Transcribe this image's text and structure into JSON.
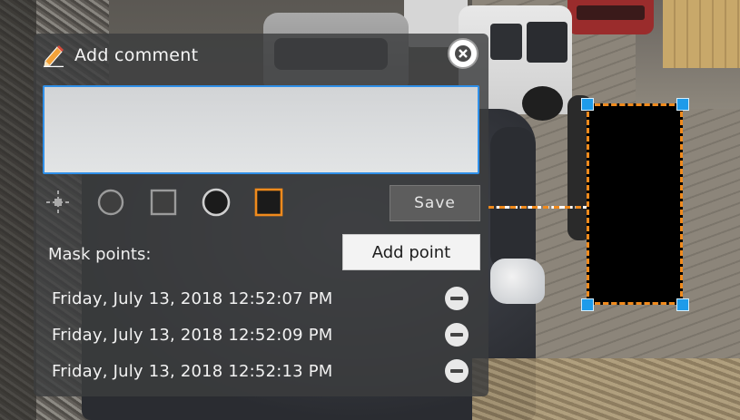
{
  "panel": {
    "title": "Add comment",
    "icons": {
      "title": "pencil-icon",
      "close": "close-icon",
      "remove": "minus-circle-icon"
    },
    "comment_value": "",
    "tools": [
      {
        "name": "point-tool",
        "icon": "crosshair-icon"
      },
      {
        "name": "circle-outline-tool",
        "icon": "circle-outline-icon"
      },
      {
        "name": "rectangle-outline-tool",
        "icon": "square-outline-icon"
      },
      {
        "name": "circle-filled-tool",
        "icon": "circle-filled-icon"
      },
      {
        "name": "rectangle-filled-tool",
        "icon": "square-filled-icon",
        "selected": true
      }
    ],
    "save_label": "Save",
    "mask_points_label": "Mask points:",
    "add_point_label": "Add point",
    "points": [
      {
        "label": "Friday, July 13, 2018 12:52:07 PM"
      },
      {
        "label": "Friday, July 13, 2018 12:52:09 PM"
      },
      {
        "label": "Friday, July 13, 2018 12:52:13 PM"
      }
    ]
  },
  "colors": {
    "accent": "#1e9bea",
    "mask_outline": "#f08a1c",
    "selected_tool": "#f08a1c",
    "panel_bg": "#3c3d3e"
  }
}
